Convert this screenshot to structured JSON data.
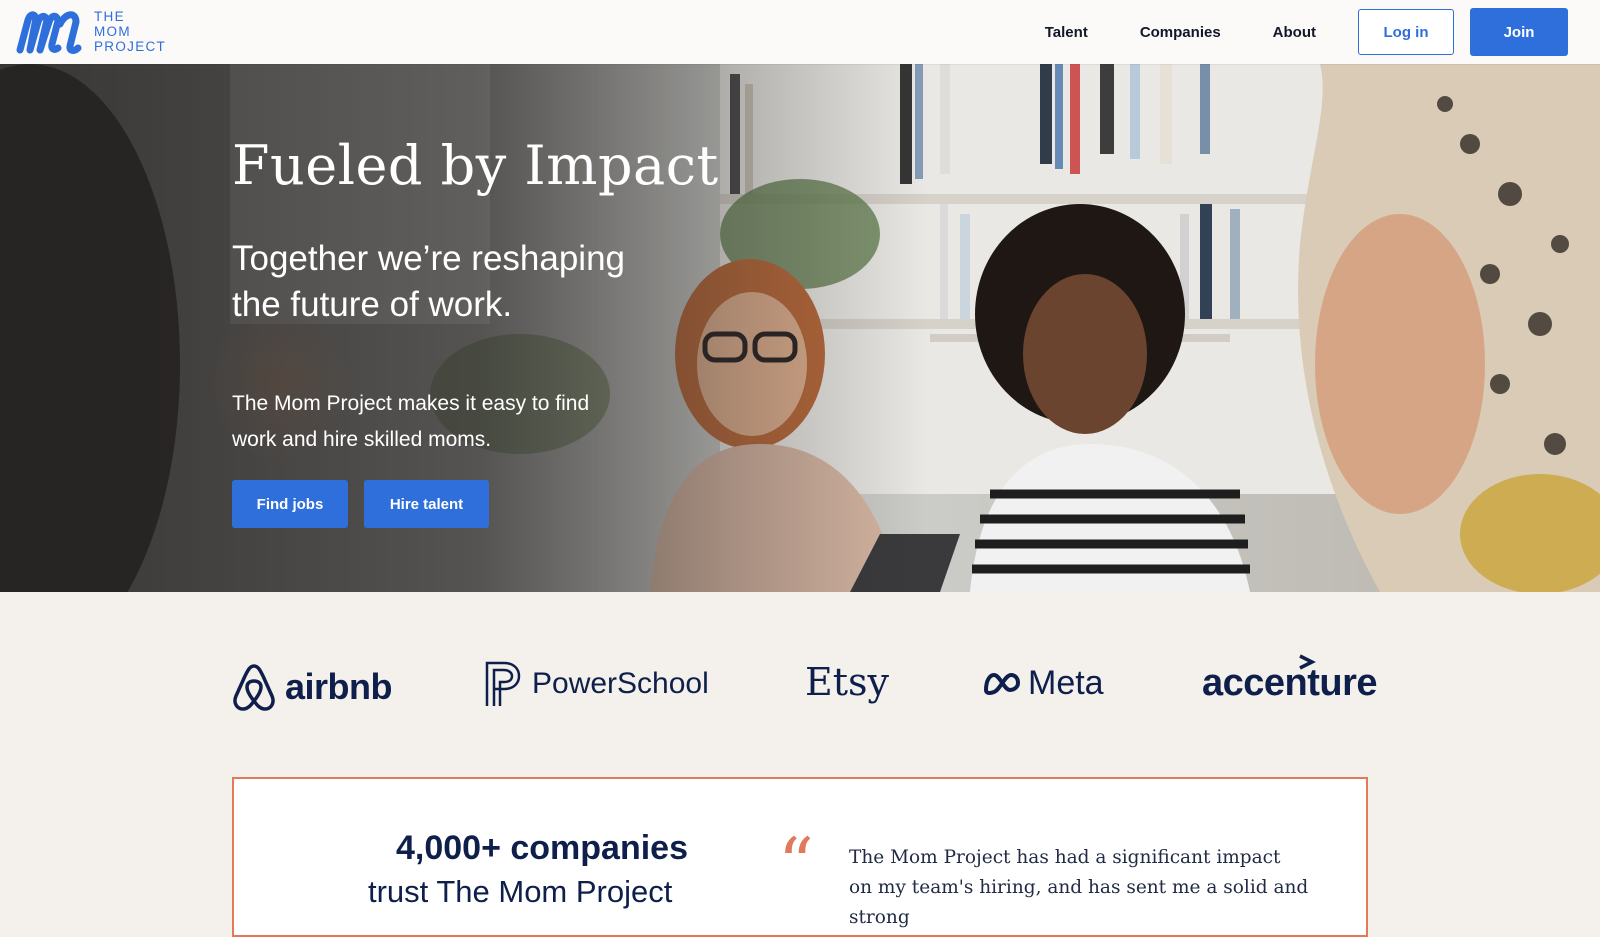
{
  "brand": {
    "logo_lines": [
      "THE",
      "MOM",
      "PROJECT"
    ],
    "accent_color": "#2f6fdb"
  },
  "nav": {
    "links": [
      "Talent",
      "Companies",
      "About"
    ],
    "login_label": "Log in",
    "join_label": "Join"
  },
  "hero": {
    "title": "Fueled by Impact",
    "subtitle": "Together we’re reshaping the future of work.",
    "description": "The Mom Project makes it easy to find work and hire skilled moms.",
    "find_jobs_label": "Find jobs",
    "hire_talent_label": "Hire talent"
  },
  "logos": {
    "items": [
      "airbnb",
      "PowerSchool",
      "Etsy",
      "Meta",
      "accenture"
    ]
  },
  "testimonial": {
    "stat_line1": "4,000+ companies",
    "stat_line2": "trust The Mom Project",
    "quote_mark": "“",
    "quote": "The Mom Project has had a significant impact on my team's hiring, and has sent me a solid and strong",
    "border_color": "#e07a5a"
  }
}
